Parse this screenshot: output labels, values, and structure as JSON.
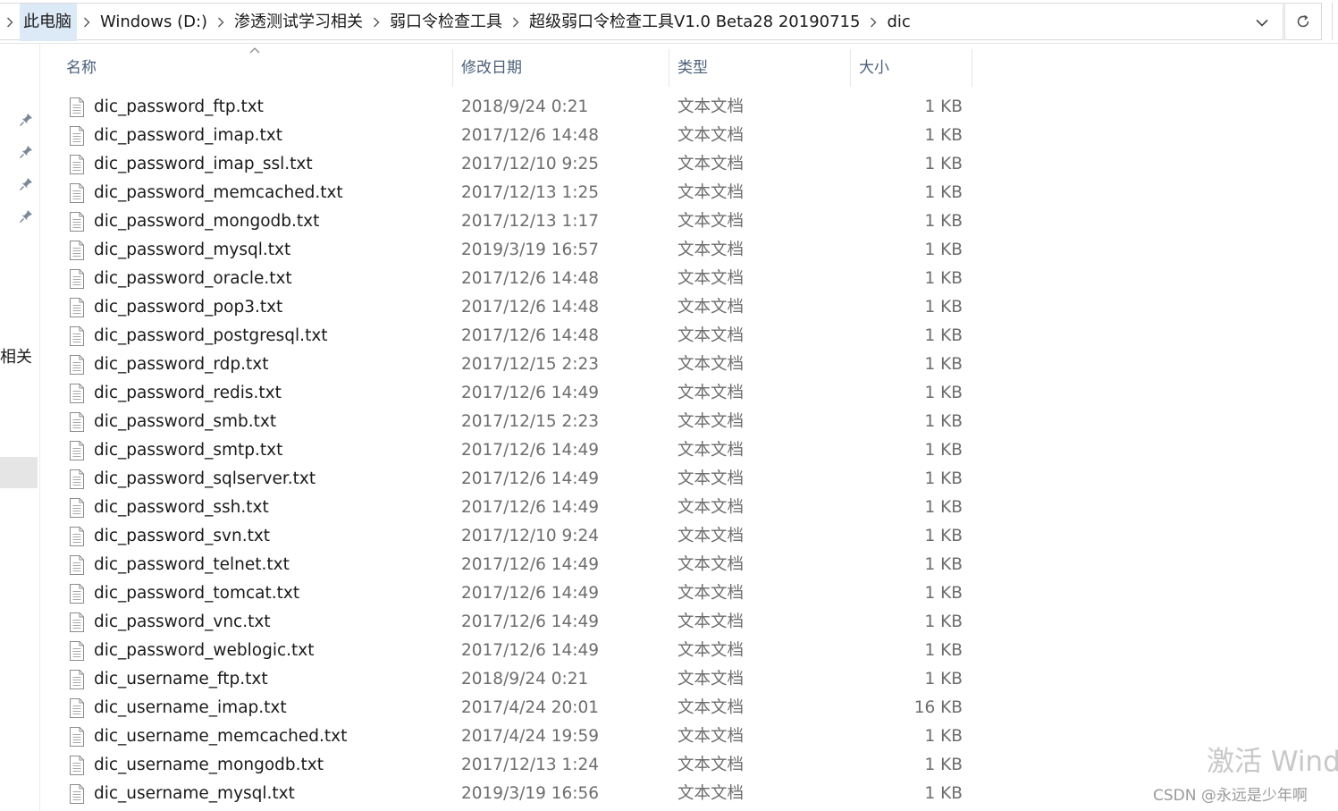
{
  "breadcrumb": [
    "此电脑",
    "Windows (D:)",
    "渗透测试学习相关",
    "弱口令检查工具",
    "超级弱口令检查工具V1.0 Beta28 20190715",
    "dic"
  ],
  "nav": {
    "partial_label": "相关"
  },
  "columns": {
    "name": "名称",
    "date": "修改日期",
    "type": "类型",
    "size": "大小"
  },
  "files": [
    {
      "name": "dic_password_ftp.txt",
      "date": "2018/9/24 0:21",
      "type": "文本文档",
      "size": "1 KB"
    },
    {
      "name": "dic_password_imap.txt",
      "date": "2017/12/6 14:48",
      "type": "文本文档",
      "size": "1 KB"
    },
    {
      "name": "dic_password_imap_ssl.txt",
      "date": "2017/12/10 9:25",
      "type": "文本文档",
      "size": "1 KB"
    },
    {
      "name": "dic_password_memcached.txt",
      "date": "2017/12/13 1:25",
      "type": "文本文档",
      "size": "1 KB"
    },
    {
      "name": "dic_password_mongodb.txt",
      "date": "2017/12/13 1:17",
      "type": "文本文档",
      "size": "1 KB"
    },
    {
      "name": "dic_password_mysql.txt",
      "date": "2019/3/19 16:57",
      "type": "文本文档",
      "size": "1 KB"
    },
    {
      "name": "dic_password_oracle.txt",
      "date": "2017/12/6 14:48",
      "type": "文本文档",
      "size": "1 KB"
    },
    {
      "name": "dic_password_pop3.txt",
      "date": "2017/12/6 14:48",
      "type": "文本文档",
      "size": "1 KB"
    },
    {
      "name": "dic_password_postgresql.txt",
      "date": "2017/12/6 14:48",
      "type": "文本文档",
      "size": "1 KB"
    },
    {
      "name": "dic_password_rdp.txt",
      "date": "2017/12/15 2:23",
      "type": "文本文档",
      "size": "1 KB"
    },
    {
      "name": "dic_password_redis.txt",
      "date": "2017/12/6 14:49",
      "type": "文本文档",
      "size": "1 KB"
    },
    {
      "name": "dic_password_smb.txt",
      "date": "2017/12/15 2:23",
      "type": "文本文档",
      "size": "1 KB"
    },
    {
      "name": "dic_password_smtp.txt",
      "date": "2017/12/6 14:49",
      "type": "文本文档",
      "size": "1 KB"
    },
    {
      "name": "dic_password_sqlserver.txt",
      "date": "2017/12/6 14:49",
      "type": "文本文档",
      "size": "1 KB"
    },
    {
      "name": "dic_password_ssh.txt",
      "date": "2017/12/6 14:49",
      "type": "文本文档",
      "size": "1 KB"
    },
    {
      "name": "dic_password_svn.txt",
      "date": "2017/12/10 9:24",
      "type": "文本文档",
      "size": "1 KB"
    },
    {
      "name": "dic_password_telnet.txt",
      "date": "2017/12/6 14:49",
      "type": "文本文档",
      "size": "1 KB"
    },
    {
      "name": "dic_password_tomcat.txt",
      "date": "2017/12/6 14:49",
      "type": "文本文档",
      "size": "1 KB"
    },
    {
      "name": "dic_password_vnc.txt",
      "date": "2017/12/6 14:49",
      "type": "文本文档",
      "size": "1 KB"
    },
    {
      "name": "dic_password_weblogic.txt",
      "date": "2017/12/6 14:49",
      "type": "文本文档",
      "size": "1 KB"
    },
    {
      "name": "dic_username_ftp.txt",
      "date": "2018/9/24 0:21",
      "type": "文本文档",
      "size": "1 KB"
    },
    {
      "name": "dic_username_imap.txt",
      "date": "2017/4/24 20:01",
      "type": "文本文档",
      "size": "16 KB"
    },
    {
      "name": "dic_username_memcached.txt",
      "date": "2017/4/24 19:59",
      "type": "文本文档",
      "size": "1 KB"
    },
    {
      "name": "dic_username_mongodb.txt",
      "date": "2017/12/13 1:24",
      "type": "文本文档",
      "size": "1 KB"
    },
    {
      "name": "dic_username_mysql.txt",
      "date": "2019/3/19 16:56",
      "type": "文本文档",
      "size": "1 KB"
    }
  ],
  "watermark": {
    "activate": "激活 Wind",
    "csdn": "CSDN @永远是少年啊"
  },
  "icons": {
    "address_dropdown": "chevron-down-icon",
    "refresh": "refresh-icon",
    "pin": "pin-icon",
    "file": "text-file-icon",
    "sort": "sort-ascending-icon"
  }
}
